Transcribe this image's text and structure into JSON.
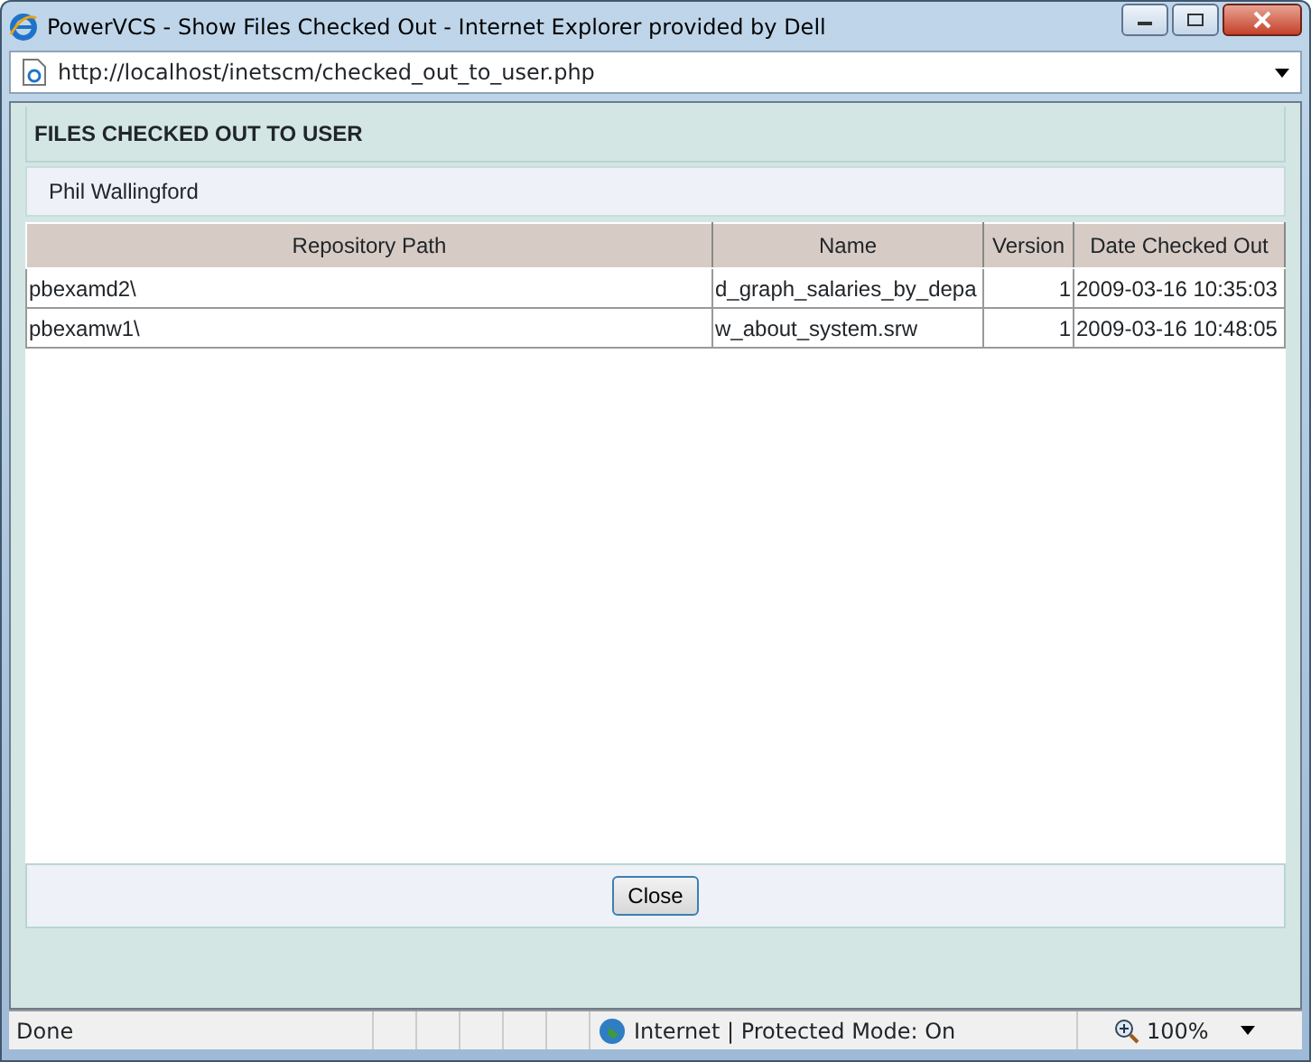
{
  "window": {
    "title": "PowerVCS - Show Files Checked Out - Internet Explorer provided by Dell"
  },
  "address_bar": {
    "url": "http://localhost/inetscm/checked_out_to_user.php"
  },
  "panel": {
    "heading": "FILES CHECKED OUT TO USER",
    "user": "Phil Wallingford"
  },
  "table": {
    "columns": [
      "Repository Path",
      "Name",
      "Version",
      "Date Checked Out"
    ],
    "rows": [
      [
        "pbexamd2\\",
        "d_graph_salaries_by_depa",
        "1",
        "2009-03-16 10:35:03"
      ],
      [
        "pbexamw1\\",
        "w_about_system.srw",
        "1",
        "2009-03-16 10:48:05"
      ]
    ]
  },
  "buttons": [
    "Close"
  ],
  "status_bar": {
    "status": "Done",
    "zone": "Internet | Protected Mode: On",
    "zoom": "100%"
  }
}
